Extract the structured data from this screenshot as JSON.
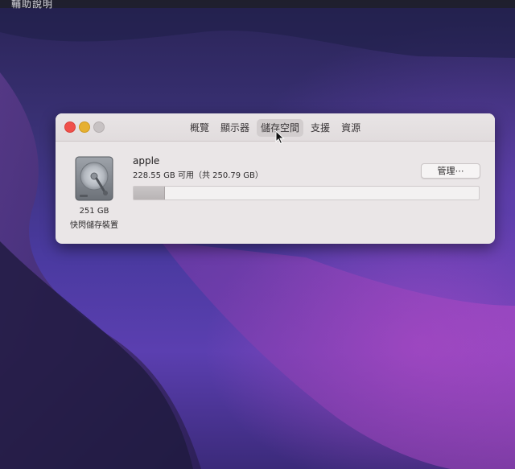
{
  "menubar": {
    "app_menu": "輔助說明"
  },
  "window": {
    "tabs": [
      {
        "label": "概覽",
        "active": false
      },
      {
        "label": "顯示器",
        "active": false
      },
      {
        "label": "儲存空間",
        "active": true
      },
      {
        "label": "支援",
        "active": false
      },
      {
        "label": "資源",
        "active": false
      }
    ]
  },
  "storage": {
    "drive_size": "251 GB",
    "drive_type": "快閃儲存裝置",
    "volume_name": "apple",
    "capacity_text": "228.55 GB 可用（共 250.79 GB）",
    "manage_label": "管理⋯",
    "used_fraction": 0.089,
    "icon": "internal-drive-icon"
  },
  "colors": {
    "close": "#f0504a",
    "minimize": "#e6b030",
    "zoom_inactive": "#c7c2c3",
    "window_bg": "#eae6e7"
  }
}
